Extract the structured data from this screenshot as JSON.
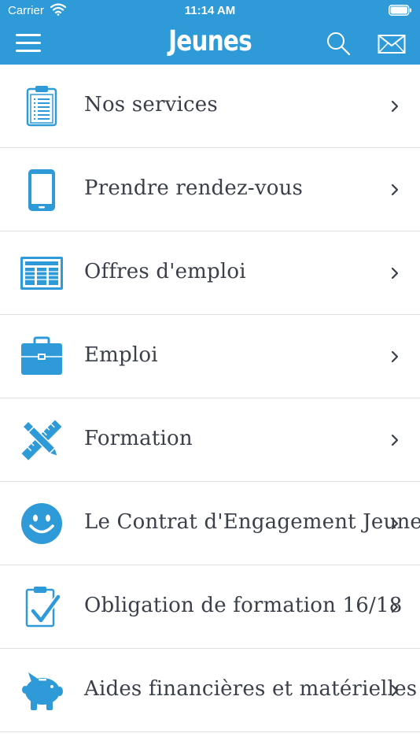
{
  "status_bar": {
    "carrier": "Carrier",
    "time": "11:14 AM"
  },
  "nav_bar": {
    "title": "Jeunes",
    "menu_icon": "hamburger-icon",
    "search_icon": "search-icon",
    "mail_icon": "mail-icon"
  },
  "colors": {
    "primary": "#2e9ad8",
    "icon": "#2e9ad8",
    "text": "#3a3f49",
    "divider": "#e0e0e0"
  },
  "menu": [
    {
      "label": "Nos services",
      "icon": "clipboard-icon"
    },
    {
      "label": "Prendre rendez-vous",
      "icon": "smartphone-icon"
    },
    {
      "label": "Offres d'emploi",
      "icon": "newspaper-icon"
    },
    {
      "label": "Emploi",
      "icon": "briefcase-icon"
    },
    {
      "label": "Formation",
      "icon": "pencil-ruler-icon"
    },
    {
      "label": "Le Contrat d'Engagement Jeune",
      "icon": "smiley-icon"
    },
    {
      "label": "Obligation de formation 16/18",
      "icon": "checklist-icon"
    },
    {
      "label": "Aides financières et matérielles",
      "icon": "piggy-bank-icon"
    }
  ]
}
